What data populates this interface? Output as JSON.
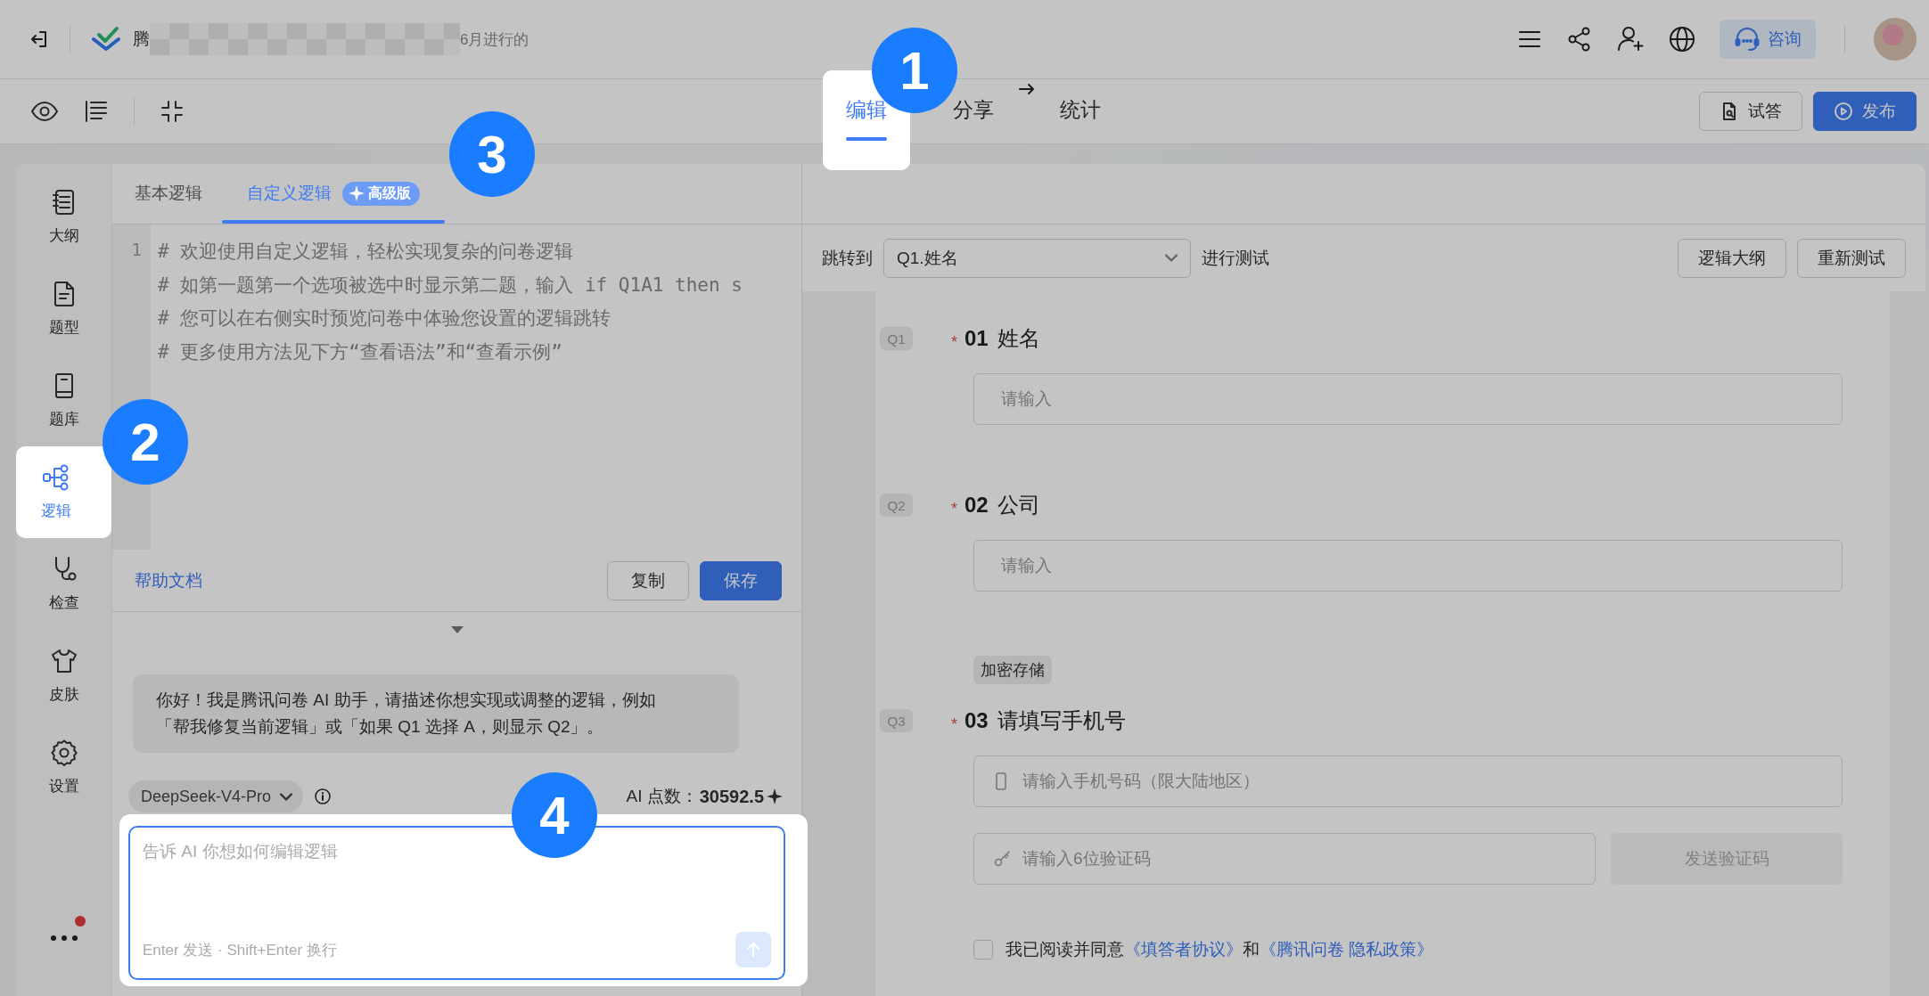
{
  "header": {
    "title_start": "腾",
    "title_end": "6月进行的",
    "consult_button": "咨询"
  },
  "toolbar": {
    "steps": [
      {
        "label": "编辑",
        "selected": true
      },
      {
        "label": "分享",
        "selected": false
      },
      {
        "label": "统计",
        "selected": false
      }
    ],
    "buttons": [
      {
        "label": "试答",
        "kind": "outline"
      },
      {
        "label": "发布",
        "kind": "primary"
      }
    ]
  },
  "sidebar": {
    "items": [
      {
        "label": "大纲",
        "kind": "outline",
        "selected": false
      },
      {
        "label": "题型",
        "kind": "types",
        "selected": false
      },
      {
        "label": "题库",
        "kind": "bank",
        "selected": false
      },
      {
        "label": "逻辑",
        "kind": "logic",
        "selected": true
      },
      {
        "label": "检查",
        "kind": "check",
        "selected": false
      },
      {
        "label": "皮肤",
        "kind": "skin",
        "selected": false
      },
      {
        "label": "设置",
        "kind": "settings",
        "selected": false
      }
    ],
    "more_notification": true
  },
  "logic_panel": {
    "tabs": [
      {
        "label": "基本逻辑",
        "selected": false
      },
      {
        "label": "自定义逻辑",
        "selected": true,
        "badge": "高级版"
      }
    ],
    "line_numbers": [
      "1"
    ],
    "code_lines": [
      "# 欢迎使用自定义逻辑，轻松实现复杂的问卷逻辑",
      "# 如第一题第一个选项被选中时显示第二题，输入 if Q1A1 then s",
      "# 您可以在右侧实时预览问卷中体验您设置的逻辑跳转",
      "# 更多使用方法见下方“查看语法”和“查看示例”"
    ],
    "help_link": "帮助文档",
    "buttons": [
      {
        "label": "复制",
        "kind": "outline"
      },
      {
        "label": "保存",
        "kind": "primary"
      }
    ]
  },
  "ai_chat": {
    "message": "你好！我是腾讯问卷 AI 助手，请描述你想实现或调整的逻辑，例如「帮我修复当前逻辑」或「如果 Q1 选择 A，则显示 Q2」。",
    "model": "DeepSeek-V4-Pro",
    "points_label": "AI 点数：",
    "points_value": "30592.5",
    "input": {
      "placeholder": "告诉 AI 你想如何编辑逻辑"
    },
    "hint": "Enter 发送 · Shift+Enter 换行"
  },
  "preview": {
    "jump_label": "跳转到",
    "jump_select": "Q1.姓名",
    "test_label": "进行测试",
    "buttons": [
      "逻辑大纲",
      "重新测试"
    ],
    "questions": [
      {
        "tag": "Q1",
        "number": "01",
        "title": "姓名",
        "required": true,
        "required_mark": "*",
        "fields": [
          {
            "kind": "text",
            "placeholder": "请输入"
          }
        ]
      },
      {
        "tag": "Q2",
        "number": "02",
        "title": "公司",
        "required": true,
        "required_mark": "*",
        "fields": [
          {
            "kind": "text",
            "placeholder": "请输入"
          }
        ]
      },
      {
        "tag": "Q3",
        "number": "03",
        "title": "请填写手机号",
        "required": true,
        "required_mark": "*",
        "note": "加密存储",
        "fields": [
          {
            "kind": "phone",
            "placeholder": "请输入手机号码（限大陆地区）"
          },
          {
            "kind": "code",
            "placeholder": "请输入6位验证码",
            "button": {
              "label": "发送验证码",
              "disabled": true
            }
          }
        ]
      }
    ],
    "agreement": {
      "checked": false,
      "text": "我已阅读并同意",
      "links": [
        "《填答者协议》",
        "《腾讯问卷 隐私政策》"
      ],
      "joiner": "和"
    }
  },
  "tour_steps": [
    "1",
    "2",
    "3",
    "4"
  ]
}
